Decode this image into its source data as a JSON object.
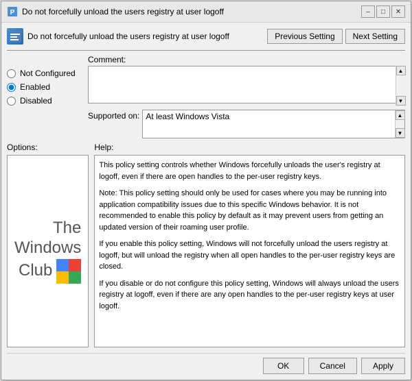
{
  "dialog": {
    "title": "Do not forcefully unload the users registry at user logoff",
    "title_icon": "policy-icon"
  },
  "header": {
    "setting_title": "Do not forcefully unload the users registry at user logoff",
    "prev_button": "Previous Setting",
    "next_button": "Next Setting"
  },
  "radio_options": {
    "not_configured": "Not Configured",
    "enabled": "Enabled",
    "disabled": "Disabled",
    "selected": "enabled"
  },
  "comment": {
    "label": "Comment:",
    "value": ""
  },
  "supported_on": {
    "label": "Supported on:",
    "value": "At least Windows Vista"
  },
  "options": {
    "label": "Options:"
  },
  "help": {
    "label": "Help:",
    "paragraphs": [
      "This policy setting  controls whether Windows forcefully unloads the user's registry at logoff, even if there are open handles to the per-user registry keys.",
      "Note: This policy setting should only be used for cases where you may be running into application compatibility issues due to this specific Windows behavior. It is not recommended to enable this policy by default as it may prevent users from getting an updated version of their roaming user profile.",
      "If you enable this policy setting, Windows will not forcefully unload the users registry at logoff, but will unload the registry when all open handles to the per-user registry keys are closed.",
      "If you disable or do not configure this policy setting, Windows will always unload the users registry at logoff, even if there are any open handles to the per-user registry keys at user logoff."
    ]
  },
  "watermark": {
    "line1": "The",
    "line2": "Windows",
    "line3": "Club"
  },
  "buttons": {
    "ok": "OK",
    "cancel": "Cancel",
    "apply": "Apply"
  },
  "title_controls": {
    "minimize": "–",
    "maximize": "□",
    "close": "✕"
  }
}
